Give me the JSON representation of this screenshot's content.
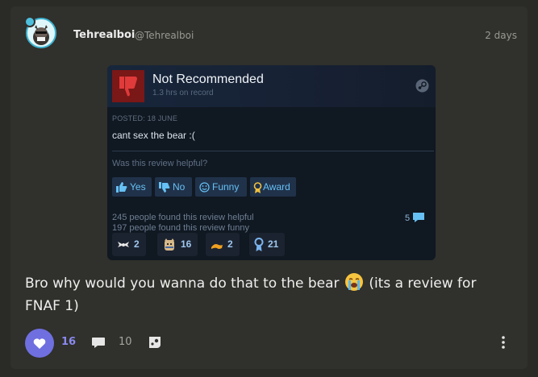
{
  "post": {
    "username": "Tehrealboi",
    "handle": "@Tehrealboi",
    "time": "2 days",
    "text_main": "Bro why would you wanna do that to the bear",
    "text_tail": "(its a review for FNAF 1)",
    "like_count": "16",
    "comment_count": "10"
  },
  "review": {
    "verdict": "Not Recommended",
    "hours": "1.3 hrs on record",
    "posted": "POSTED: 18 JUNE",
    "text": "cant sex the bear :(",
    "helpful_question": "Was this review helpful?",
    "buttons": {
      "yes": "Yes",
      "no": "No",
      "funny": "Funny",
      "award": "Award"
    },
    "helpful_stat": "245 people found this review helpful",
    "funny_stat": "197 people found this review funny",
    "comments": "5",
    "awards": [
      "2",
      "16",
      "2",
      "21"
    ]
  },
  "icons": [
    "avatar",
    "thumbs-down-icon",
    "steam-logo-icon",
    "thumbs-up-icon",
    "smile-icon",
    "award-ribbon-icon",
    "comment-bubble-icon",
    "heart-icon",
    "comment-icon",
    "steam-share-icon",
    "more-vertical-icon",
    "crying-emoji-icon"
  ],
  "colors": {
    "accent": "#6f6fe0",
    "steam_blue": "#66c0f4",
    "not_recommended": "#a52525"
  }
}
